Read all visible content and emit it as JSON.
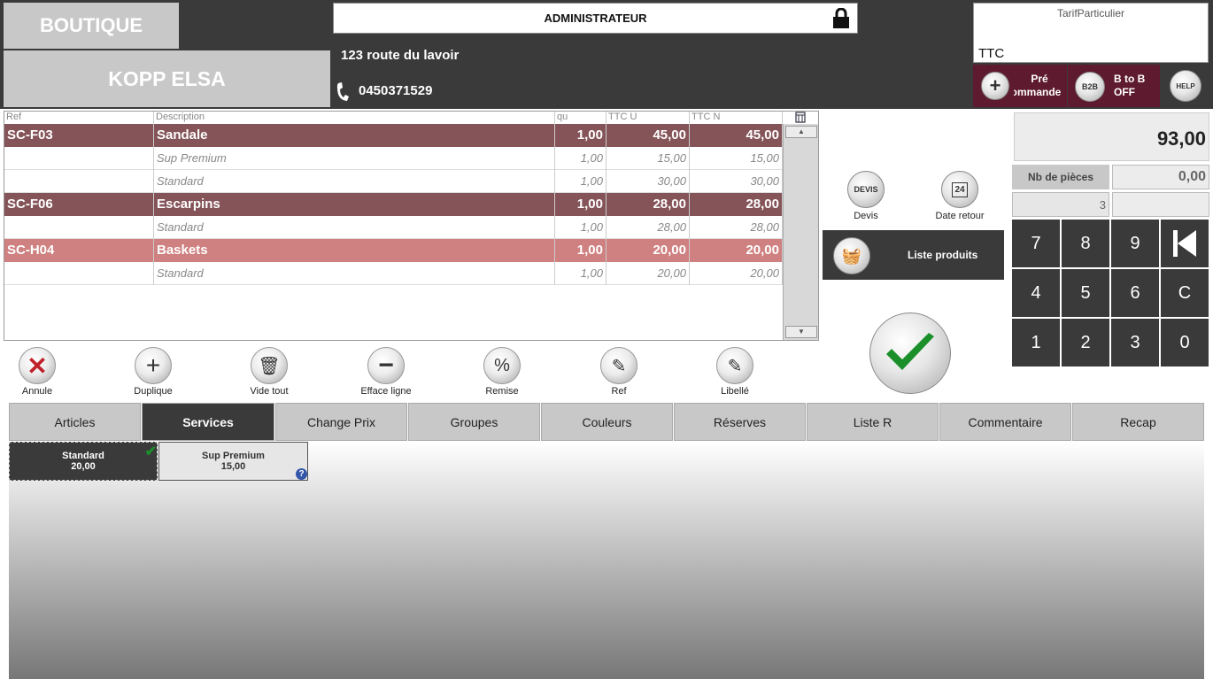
{
  "header": {
    "shop": "BOUTIQUE",
    "client": "KOPP ELSA",
    "user": "ADMINISTRATEUR",
    "address": "123 route du lavoir",
    "phone": "0450371529",
    "tarif_label": "TarifParticulier",
    "price_mode": "TTC",
    "precommande_label_1": "Pré",
    "precommande_label_2": "ommande",
    "b2b_icon": "B2B",
    "b2b_label_1": "B to B",
    "b2b_label_2": "OFF",
    "help_icon": "HELP"
  },
  "table": {
    "headers": [
      "Ref",
      "Description",
      "qu",
      "TTC U",
      "TTC N"
    ],
    "rows": [
      {
        "ref": "SC-F03",
        "desc": "Sandale",
        "qty": "1,00",
        "unit": "45,00",
        "net": "45,00"
      },
      {
        "ref": "",
        "desc": "Sup Premium",
        "qty": "1,00",
        "unit": "15,00",
        "net": "15,00"
      },
      {
        "ref": "",
        "desc": "Standard",
        "qty": "1,00",
        "unit": "30,00",
        "net": "30,00"
      },
      {
        "ref": "SC-F06",
        "desc": "Escarpins",
        "qty": "1,00",
        "unit": "28,00",
        "net": "28,00"
      },
      {
        "ref": "",
        "desc": "Standard",
        "qty": "1,00",
        "unit": "28,00",
        "net": "28,00"
      },
      {
        "ref": "SC-H04",
        "desc": "Baskets",
        "qty": "1,00",
        "unit": "20,00",
        "net": "20,00"
      },
      {
        "ref": "",
        "desc": "Standard",
        "qty": "1,00",
        "unit": "20,00",
        "net": "20,00"
      }
    ]
  },
  "tools": {
    "annule": "Annule",
    "duplique": "Duplique",
    "vide_tout": "Vide tout",
    "efface_ligne": "Efface ligne",
    "remise": "Remise",
    "ref": "Ref",
    "libelle": "Libellé"
  },
  "side": {
    "devis_icon": "DEVIS",
    "devis": "Devis",
    "date_icon": "24",
    "date_retour": "Date retour",
    "liste_produits": "Liste produits"
  },
  "totals": {
    "total": "93,00",
    "nb_pieces_label": "Nb de pièces",
    "nb_pieces_value": "0,00",
    "count": "3"
  },
  "keypad": [
    "7",
    "8",
    "9",
    "4",
    "5",
    "6",
    "C",
    "1",
    "2",
    "3",
    "0"
  ],
  "tabs": [
    "Articles",
    "Services",
    "Change Prix",
    "Groupes",
    "Couleurs",
    "Réserves",
    "Liste R",
    "Commentaire",
    "Recap"
  ],
  "active_tab": "Services",
  "services": [
    {
      "name": "Standard",
      "price": "20,00"
    },
    {
      "name": "Sup Premium",
      "price": "15,00"
    }
  ],
  "colors": {
    "dark_row": "#855458",
    "pink_row": "#cf8080",
    "top_bar": "#3a3a3a",
    "accent_red": "#5e1a2e",
    "check_green": "#1a8f2a"
  }
}
